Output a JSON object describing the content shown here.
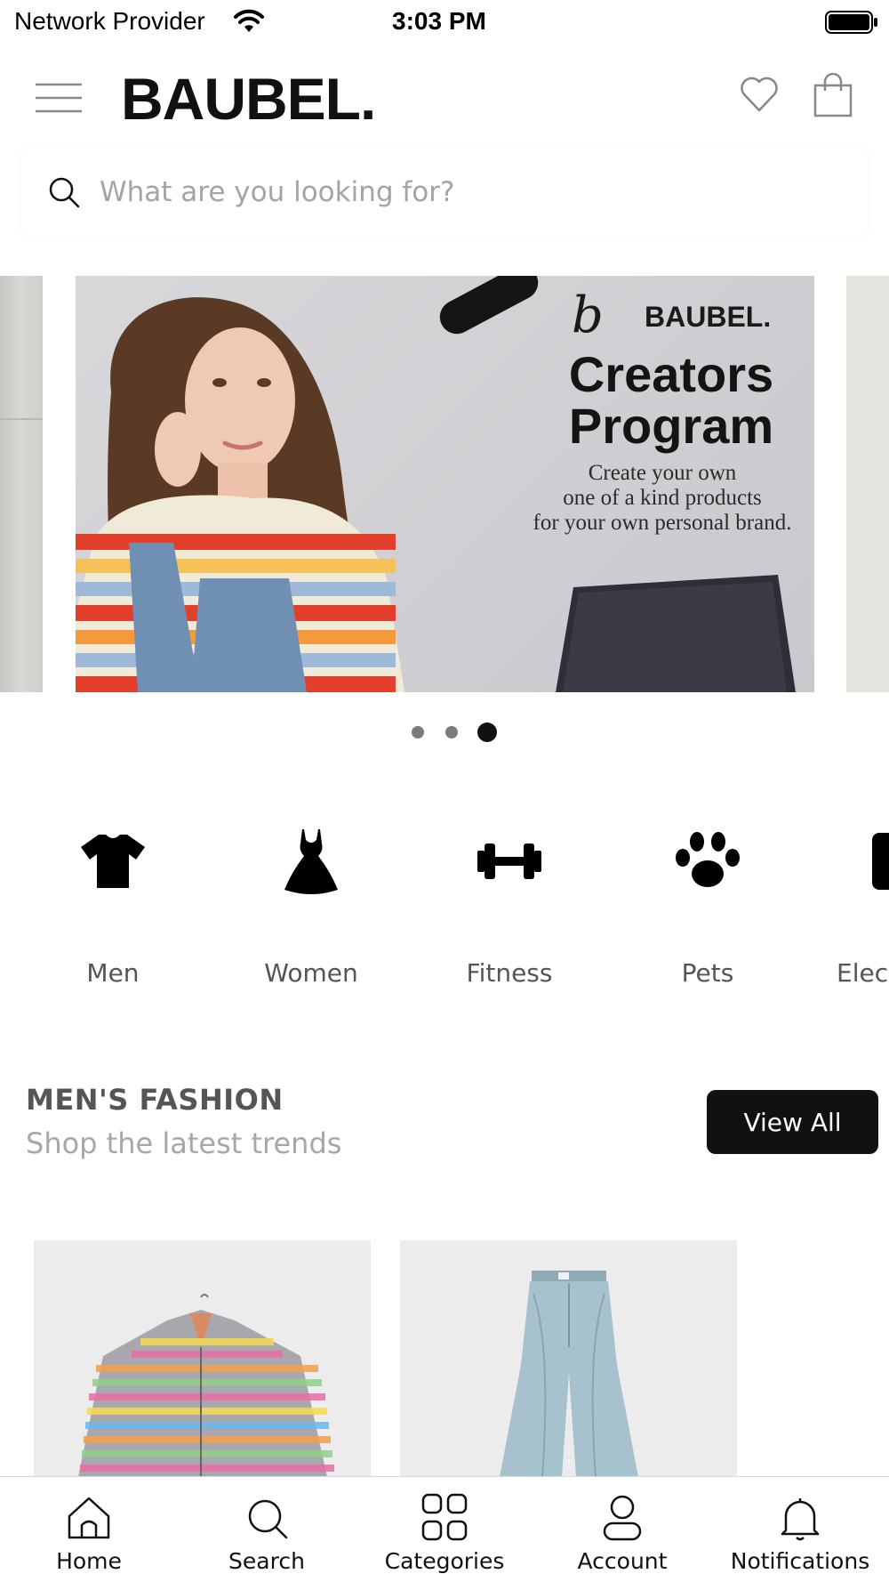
{
  "status_bar": {
    "carrier": "Network Provider",
    "time": "3:03 PM",
    "wifi_icon": "wifi-icon",
    "battery_icon": "battery-icon"
  },
  "header": {
    "brand": "BAUBEL.",
    "menu_icon": "hamburger-menu-icon",
    "wishlist_icon": "heart-icon",
    "bag_icon": "shopping-bag-icon"
  },
  "search": {
    "placeholder": "What are you looking for?",
    "value": "",
    "icon": "search-icon"
  },
  "banner": {
    "brand": "BAUBEL.",
    "signature": "b",
    "title_line1": "Creators",
    "title_line2": "Program",
    "subtitle_line1": "Create your own",
    "subtitle_line2": "one of a kind products",
    "subtitle_line3": "for your own personal brand.",
    "slide_count": 3,
    "active_slide": 3
  },
  "categories": [
    {
      "label": "Men",
      "icon": "t-shirt-icon"
    },
    {
      "label": "Women",
      "icon": "dress-icon"
    },
    {
      "label": "Fitness",
      "icon": "dumbbell-icon"
    },
    {
      "label": "Pets",
      "icon": "paw-icon"
    },
    {
      "label": "Elec",
      "icon": "electronics-icon"
    }
  ],
  "section": {
    "title": "MEN'S FASHION",
    "subtitle": "Shop the latest trends",
    "view_all": "View All"
  },
  "products": [
    {
      "image": "colorful-denim-jacket-image"
    },
    {
      "image": "light-wash-jeans-image"
    }
  ],
  "tab_bar": {
    "items": [
      {
        "label": "Home",
        "icon": "home-icon"
      },
      {
        "label": "Search",
        "icon": "search-icon"
      },
      {
        "label": "Categories",
        "icon": "grid-icon"
      },
      {
        "label": "Account",
        "icon": "user-icon"
      },
      {
        "label": "Notifications",
        "icon": "bell-icon"
      }
    ]
  },
  "colors": {
    "accent": "#111111",
    "muted_text": "#555555",
    "placeholder_text": "#a4a4a4",
    "dot_inactive": "#7c7c7c"
  }
}
